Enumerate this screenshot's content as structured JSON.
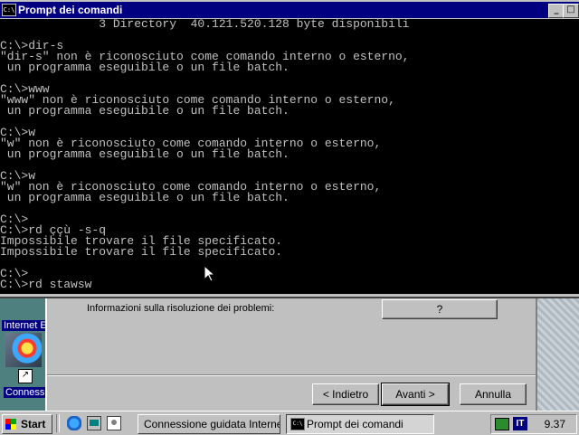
{
  "command_window": {
    "title": "Prompt dei comandi",
    "icon_text": "C:\\",
    "minimize_label": "_",
    "maximize_label": "□",
    "console_lines": [
      "              3 Directory  40.121.520.128 byte disponibili",
      "",
      "C:\\>dir-s",
      "\"dir-s\" non è riconosciuto come comando interno o esterno,",
      " un programma eseguibile o un file batch.",
      "",
      "C:\\>www",
      "\"www\" non è riconosciuto come comando interno o esterno,",
      " un programma eseguibile o un file batch.",
      "",
      "C:\\>w",
      "\"w\" non è riconosciuto come comando interno o esterno,",
      " un programma eseguibile o un file batch.",
      "",
      "C:\\>w",
      "\"w\" non è riconosciuto come comando interno o esterno,",
      " un programma eseguibile o un file batch.",
      "",
      "C:\\>",
      "C:\\>rd ççù -s-q",
      "Impossibile trovare il file specificato.",
      "Impossibile trovare il file specificato.",
      "",
      "C:\\>",
      "C:\\>rd stawsw"
    ]
  },
  "wizard": {
    "info_label": "Informazioni sulla risoluzione dei problemi:",
    "help_button": "?",
    "back_button": "< Indietro",
    "next_button": "Avanti >",
    "cancel_button": "Annulla"
  },
  "desktop": {
    "ie_label": "Internet E",
    "shortcut_arrow": "↗",
    "conn_label": "Connessi"
  },
  "taskbar": {
    "start_label": "Start",
    "tasks": [
      {
        "label": "Connessione guidata Internet"
      },
      {
        "label": "Prompt dei comandi",
        "icon_text": "C:\\",
        "active": true
      }
    ],
    "tray": {
      "lang": "IT",
      "clock": "9.37"
    }
  },
  "colors": {
    "title_bar": "#000080",
    "console_bg": "#000000",
    "console_text": "#c0c0c0",
    "face": "#c0c0c0"
  }
}
